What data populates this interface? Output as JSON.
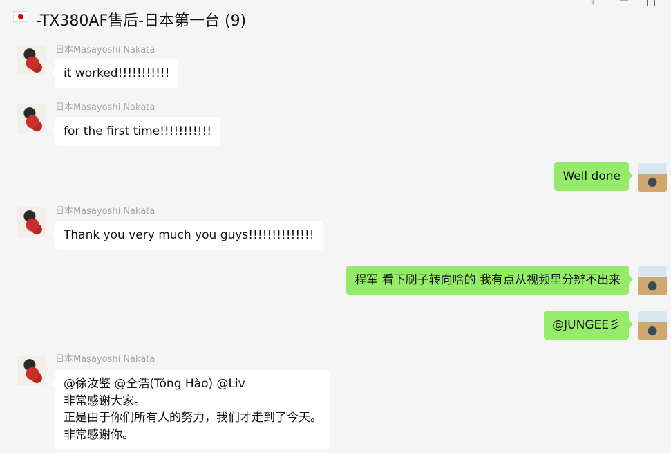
{
  "header": {
    "flag": "🇯🇵",
    "title": "-TX380AF售后-日本第一台 (9)"
  },
  "messages": [
    {
      "sender": "日本Masayoshi Nakata",
      "text": "it worked!!!!!!!!!!!"
    },
    {
      "sender": "日本Masayoshi Nakata",
      "text": "for the first time!!!!!!!!!!!"
    },
    {
      "text": "Well done"
    },
    {
      "sender": "日本Masayoshi Nakata",
      "text": "Thank you very much you guys!!!!!!!!!!!!!!"
    },
    {
      "text": "程军  看下刷子转向啥的  我有点从视频里分辨不出来"
    },
    {
      "text": "@JUNGEE彡"
    },
    {
      "sender": "日本Masayoshi Nakata",
      "lines": [
        "@徐汝鉴 @仝浩(Tóng Hào) @Liv",
        "非常感谢大家。",
        "正是由于你们所有人的努力，我们才走到了今天。",
        "非常感谢你。"
      ]
    }
  ]
}
